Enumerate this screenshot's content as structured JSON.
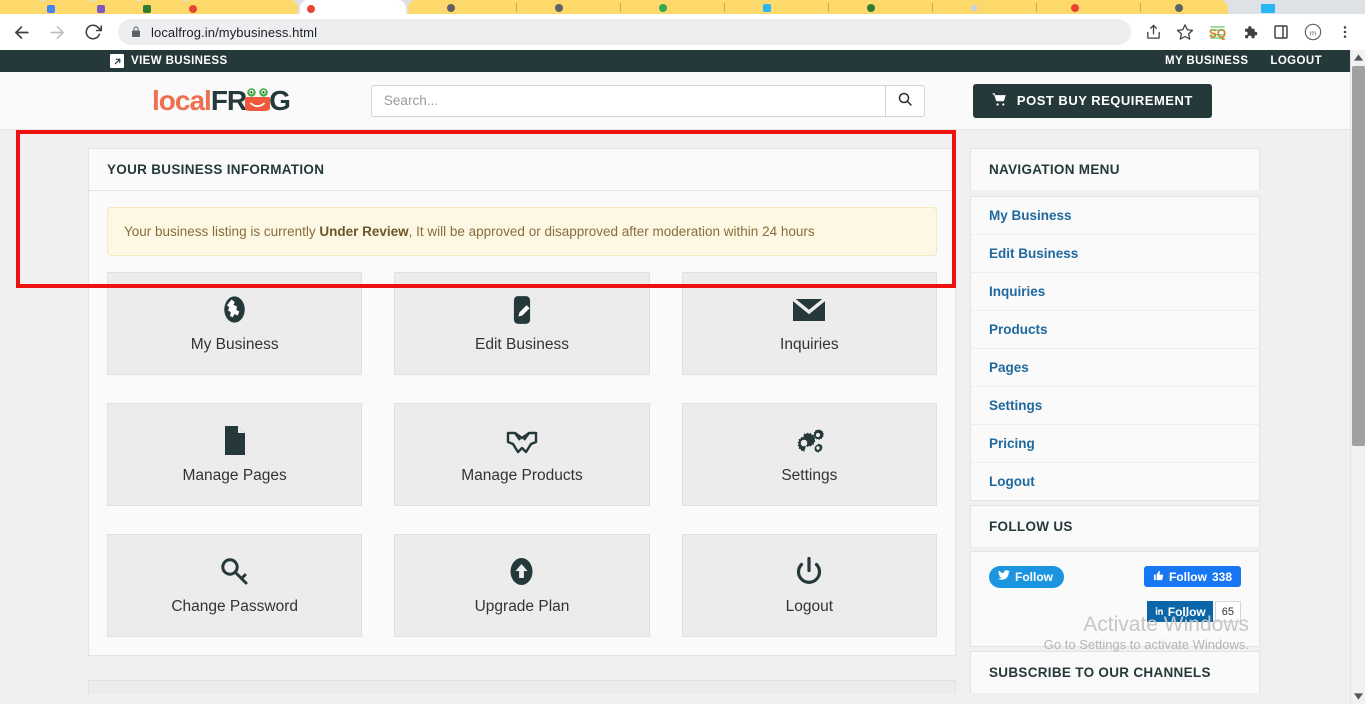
{
  "browser": {
    "url_prefix": "localfrog",
    "url_domain": ".in",
    "url_path": "/mybusiness.html",
    "url_full": "localfrog.in/mybusiness.html",
    "back_icon": "back-arrow-icon",
    "forward_icon": "forward-arrow-icon",
    "reload_icon": "reload-icon",
    "lock_icon": "lock-icon",
    "share_icon": "share-icon",
    "bookmark_icon": "star-icon",
    "extension_sq_icon": "sq-extension-icon",
    "extensions_icon": "puzzle-piece-icon",
    "sidepanel_icon": "side-panel-icon",
    "profile_icon": "profile-avatar-icon",
    "menu_icon": "three-dot-menu-icon",
    "tabs": [
      {
        "color": "#34a853"
      },
      {
        "color": "#4285f4"
      },
      {
        "color": "#7e57c2"
      },
      {
        "color": "#2e7d32"
      },
      {
        "color": "#ea4335"
      },
      {
        "color": "#ea4335"
      },
      {
        "color": "#5f6368"
      },
      {
        "color": "#5f6368"
      },
      {
        "color": "#34a853"
      },
      {
        "color": "#29b6f6"
      },
      {
        "color": "#2e7d32"
      },
      {
        "color": "#9e9e9e"
      },
      {
        "color": "#ea4335"
      },
      {
        "color": "#5f6368"
      },
      {
        "color": "#bdbdbd"
      }
    ]
  },
  "topbar": {
    "view_business": "VIEW BUSINESS",
    "view_business_icon": "external-link-icon",
    "links": [
      "MY BUSINESS",
      "LOGOUT"
    ]
  },
  "header": {
    "logo_part1": "local",
    "logo_part2": "FR",
    "logo_part3": "G",
    "logo_frog_icon": "frog-face-icon",
    "search_placeholder": "Search...",
    "search_value": "",
    "search_icon": "magnifier-icon",
    "post_button_label": "POST BUY REQUIREMENT",
    "post_button_icon": "shopping-cart-icon"
  },
  "main": {
    "panel_title": "YOUR BUSINESS INFORMATION",
    "alert_prefix": "Your business listing is currently ",
    "alert_status": "Under Review",
    "alert_suffix": ", It will be approved or disapproved after moderation within 24 hours",
    "tiles": [
      {
        "label": "My Business",
        "icon": "globe-icon"
      },
      {
        "label": "Edit Business",
        "icon": "pencil-square-icon"
      },
      {
        "label": "Inquiries",
        "icon": "envelope-icon"
      },
      {
        "label": "Manage Pages",
        "icon": "file-document-icon"
      },
      {
        "label": "Manage Products",
        "icon": "handshake-icon"
      },
      {
        "label": "Settings",
        "icon": "gears-icon"
      },
      {
        "label": "Change Password",
        "icon": "key-icon"
      },
      {
        "label": "Upgrade Plan",
        "icon": "arrow-up-circle-icon"
      },
      {
        "label": "Logout",
        "icon": "power-off-icon"
      }
    ]
  },
  "sidebar": {
    "nav_title": "NAVIGATION MENU",
    "nav_items": [
      {
        "label": "My Business"
      },
      {
        "label": "Edit Business"
      },
      {
        "label": "Inquiries"
      },
      {
        "label": "Products"
      },
      {
        "label": "Pages"
      },
      {
        "label": "Settings"
      },
      {
        "label": "Pricing"
      },
      {
        "label": "Logout"
      }
    ],
    "follow_title": "FOLLOW US",
    "twitter_label": "Follow",
    "twitter_icon": "twitter-bird-icon",
    "facebook_label": "Follow",
    "facebook_count": "338",
    "facebook_icon": "thumbs-up-icon",
    "linkedin_label": "Follow",
    "linkedin_count": "65",
    "linkedin_icon": "linkedin-in-icon",
    "subscribe_title": "SUBSCRIBE TO OUR CHANNELS"
  },
  "watermark": {
    "line1": "Activate Windows",
    "line2": "Go to Settings to activate Windows."
  },
  "colors": {
    "brand_dark": "#25393a",
    "brand_orange": "#ef6f51",
    "link_blue": "#20699e",
    "alert_bg": "#fcf8e3",
    "annotation_red": "#ee1111"
  }
}
